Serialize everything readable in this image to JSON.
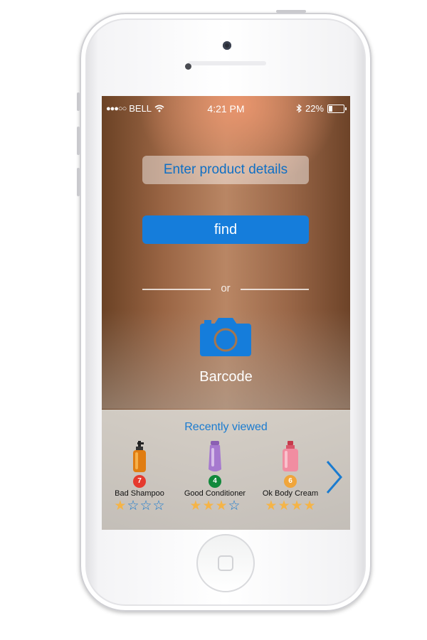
{
  "status_bar": {
    "carrier": "BELL",
    "signal_dots": "●●●○○",
    "time": "4:21 PM",
    "battery_percent": "22%",
    "battery_level": 0.22
  },
  "main": {
    "details_button_label": "Enter product details",
    "find_button_label": "find",
    "divider_text": "or",
    "barcode_label": "Barcode"
  },
  "recent": {
    "title": "Recently viewed",
    "items": [
      {
        "name": "Bad Shampoo",
        "score": "7",
        "badge_color": "#e53a2e",
        "rating": 1,
        "max_rating": 4,
        "icon": "shampoo-bottle-icon"
      },
      {
        "name": "Good Conditioner",
        "score": "4",
        "badge_color": "#11893b",
        "rating": 3,
        "max_rating": 4,
        "icon": "conditioner-bottle-icon"
      },
      {
        "name": "Ok Body Cream",
        "score": "6",
        "badge_color": "#f0a53b",
        "rating": 4,
        "max_rating": 4,
        "icon": "body-cream-bottle-icon"
      }
    ]
  },
  "colors": {
    "accent_blue": "#157ddb",
    "star_filled": "#f5b447",
    "star_empty": "#1a7bd0"
  }
}
